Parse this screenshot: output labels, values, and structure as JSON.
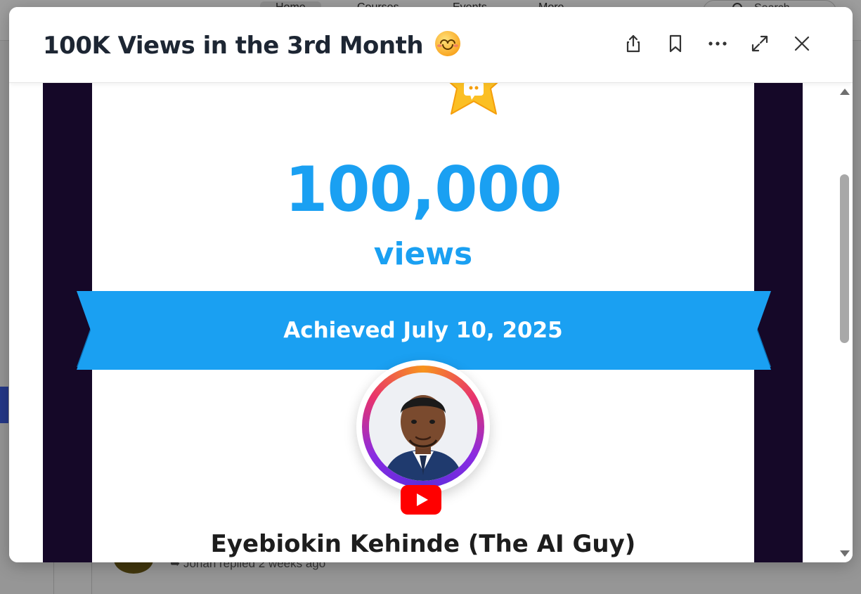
{
  "background": {
    "nav_items": [
      "Home",
      "Courses",
      "Events",
      "More"
    ],
    "search_placeholder": "Search",
    "reply_text": "Jonah replied 2 weeks ago"
  },
  "modal": {
    "title": "100K Views in the 3rd Month",
    "title_emoji": "smiling-face-emoji",
    "actions": {
      "share": "share-icon",
      "bookmark": "bookmark-icon",
      "more": "more-icon",
      "expand": "expand-icon",
      "close": "close-icon"
    }
  },
  "post_image": {
    "count": "100,000",
    "unit": "views",
    "achieved": "Achieved July 10, 2025",
    "name": "Eyebiokin Kehinde (The AI Guy)"
  },
  "colors": {
    "accent_blue": "#1aa0f2",
    "title_dark": "#1d2633",
    "frame_purple": "#1c0c34",
    "youtube_red": "#ff0000",
    "star_gold": "#fbbf24"
  }
}
